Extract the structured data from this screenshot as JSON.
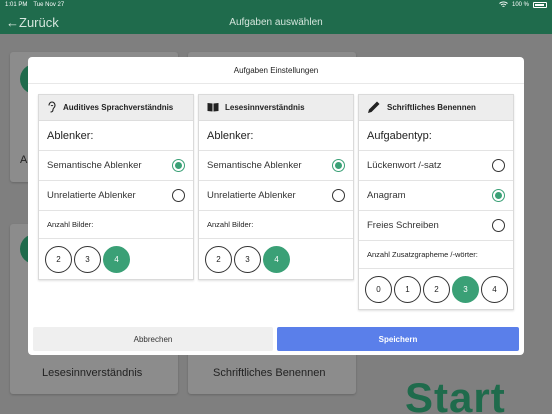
{
  "status_bar": {
    "time": "1:01 PM",
    "date": "Tue Nov 27",
    "battery": "100 %"
  },
  "nav": {
    "back_label": "←Zurück",
    "title": "Aufgaben auswählen"
  },
  "background": {
    "card_labels": [
      "Lesesinnverständnis",
      "Schriftliches Benennen"
    ],
    "partial_label": "A",
    "start_label": "Start"
  },
  "modal": {
    "title": "Aufgaben Einstellungen",
    "panels": [
      {
        "icon": "ear-icon",
        "header": "Auditives Sprachverständnis",
        "section": "Ablenker:",
        "options": [
          {
            "label": "Semantische Ablenker",
            "selected": true
          },
          {
            "label": "Unrelatierte Ablenker",
            "selected": false
          }
        ],
        "count_label": "Anzahl Bilder:",
        "counts": [
          "2",
          "3",
          "4"
        ],
        "selected_count": "4"
      },
      {
        "icon": "book-icon",
        "header": "Lesesinnverständnis",
        "section": "Ablenker:",
        "options": [
          {
            "label": "Semantische Ablenker",
            "selected": true
          },
          {
            "label": "Unrelatierte Ablenker",
            "selected": false
          }
        ],
        "count_label": "Anzahl Bilder:",
        "counts": [
          "2",
          "3",
          "4"
        ],
        "selected_count": "4"
      },
      {
        "icon": "pencil-icon",
        "header": "Schriftliches Benennen",
        "section": "Aufgabentyp:",
        "options": [
          {
            "label": "Lückenwort /-satz",
            "selected": false
          },
          {
            "label": "Anagram",
            "selected": true
          },
          {
            "label": "Freies Schreiben",
            "selected": false
          }
        ],
        "count_label": "Anzahl Zusatzgrapheme /-wörter:",
        "counts": [
          "0",
          "1",
          "2",
          "3",
          "4"
        ],
        "selected_count": "3"
      }
    ],
    "cancel_label": "Abbrechen",
    "save_label": "Speichern"
  },
  "colors": {
    "accent_green": "#3aa076",
    "nav_green": "#1f6b4c",
    "save_blue": "#5a7fea"
  }
}
